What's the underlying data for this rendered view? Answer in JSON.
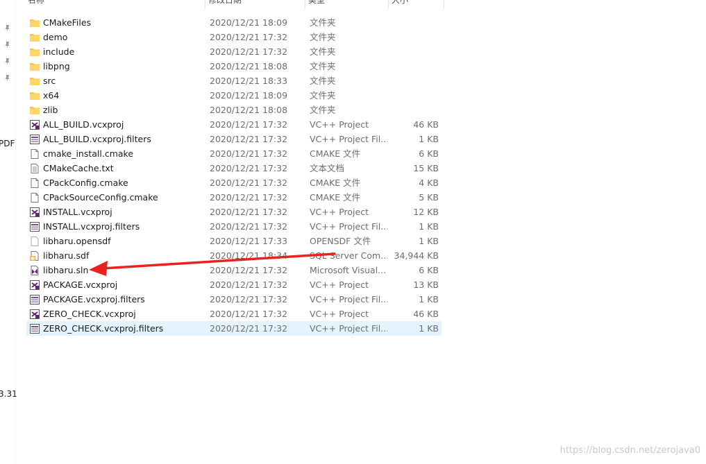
{
  "nav": {
    "text_top": "PDF",
    "text_bottom": "3.31"
  },
  "headers": {
    "name": "名称",
    "date": "修改日期",
    "type": "类型",
    "size": "大小"
  },
  "files": [
    {
      "name": "CMakeFiles",
      "date": "2020/12/21 18:09",
      "type": "文件夹",
      "size": "",
      "icon": "folder-icon"
    },
    {
      "name": "demo",
      "date": "2020/12/21 17:32",
      "type": "文件夹",
      "size": "",
      "icon": "folder-icon"
    },
    {
      "name": "include",
      "date": "2020/12/21 17:32",
      "type": "文件夹",
      "size": "",
      "icon": "folder-icon"
    },
    {
      "name": "libpng",
      "date": "2020/12/21 18:08",
      "type": "文件夹",
      "size": "",
      "icon": "folder-icon"
    },
    {
      "name": "src",
      "date": "2020/12/21 18:33",
      "type": "文件夹",
      "size": "",
      "icon": "folder-icon"
    },
    {
      "name": "x64",
      "date": "2020/12/21 18:09",
      "type": "文件夹",
      "size": "",
      "icon": "folder-icon"
    },
    {
      "name": "zlib",
      "date": "2020/12/21 18:08",
      "type": "文件夹",
      "size": "",
      "icon": "folder-icon"
    },
    {
      "name": "ALL_BUILD.vcxproj",
      "date": "2020/12/21 17:32",
      "type": "VC++ Project",
      "size": "46 KB",
      "icon": "vcxproj-icon"
    },
    {
      "name": "ALL_BUILD.vcxproj.filters",
      "date": "2020/12/21 17:32",
      "type": "VC++ Project Fil...",
      "size": "1 KB",
      "icon": "filters-icon"
    },
    {
      "name": "cmake_install.cmake",
      "date": "2020/12/21 17:32",
      "type": "CMAKE 文件",
      "size": "6 KB",
      "icon": "file-icon"
    },
    {
      "name": "CMakeCache.txt",
      "date": "2020/12/21 17:32",
      "type": "文本文档",
      "size": "15 KB",
      "icon": "text-file-icon"
    },
    {
      "name": "CPackConfig.cmake",
      "date": "2020/12/21 17:32",
      "type": "CMAKE 文件",
      "size": "4 KB",
      "icon": "file-icon"
    },
    {
      "name": "CPackSourceConfig.cmake",
      "date": "2020/12/21 17:32",
      "type": "CMAKE 文件",
      "size": "5 KB",
      "icon": "file-icon"
    },
    {
      "name": "INSTALL.vcxproj",
      "date": "2020/12/21 17:32",
      "type": "VC++ Project",
      "size": "12 KB",
      "icon": "vcxproj-icon"
    },
    {
      "name": "INSTALL.vcxproj.filters",
      "date": "2020/12/21 17:32",
      "type": "VC++ Project Fil...",
      "size": "1 KB",
      "icon": "filters-icon"
    },
    {
      "name": "libharu.opensdf",
      "date": "2020/12/21 17:33",
      "type": "OPENSDF 文件",
      "size": "1 KB",
      "icon": "blank-file-icon"
    },
    {
      "name": "libharu.sdf",
      "date": "2020/12/21 18:34",
      "type": "SQL Server Com...",
      "size": "34,944 KB",
      "icon": "sdf-icon"
    },
    {
      "name": "libharu.sln",
      "date": "2020/12/21 17:32",
      "type": "Microsoft Visual...",
      "size": "6 KB",
      "icon": "sln-icon"
    },
    {
      "name": "PACKAGE.vcxproj",
      "date": "2020/12/21 17:32",
      "type": "VC++ Project",
      "size": "13 KB",
      "icon": "vcxproj-icon"
    },
    {
      "name": "PACKAGE.vcxproj.filters",
      "date": "2020/12/21 17:32",
      "type": "VC++ Project Fil...",
      "size": "1 KB",
      "icon": "filters-icon"
    },
    {
      "name": "ZERO_CHECK.vcxproj",
      "date": "2020/12/21 17:32",
      "type": "VC++ Project",
      "size": "46 KB",
      "icon": "vcxproj-icon"
    },
    {
      "name": "ZERO_CHECK.vcxproj.filters",
      "date": "2020/12/21 17:32",
      "type": "VC++ Project Fil...",
      "size": "1 KB",
      "icon": "filters-icon",
      "selected": true
    }
  ],
  "colors": {
    "arrow": "#e8231f",
    "selection": "#e5f3ff",
    "folder": "#f5c54a"
  },
  "watermark": "https://blog.csdn.net/zerojava0"
}
